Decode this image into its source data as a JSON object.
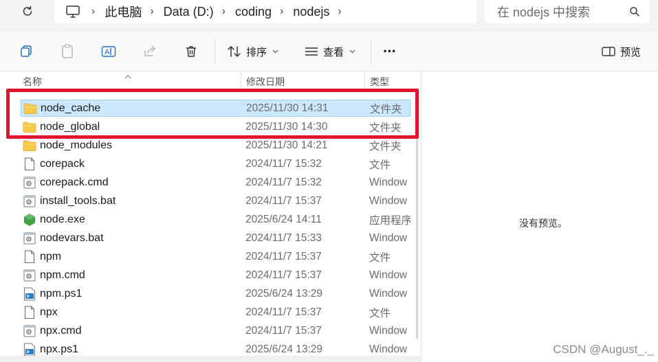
{
  "address": {
    "breadcrumbs": [
      "此电脑",
      "Data (D:)",
      "coding",
      "nodejs"
    ]
  },
  "search": {
    "placeholder": "在 nodejs 中搜索"
  },
  "toolbar": {
    "sort_label": "排序",
    "view_label": "查看",
    "more_label": "···",
    "preview_label": "预览"
  },
  "columns": {
    "name": "名称",
    "modified": "修改日期",
    "type": "类型"
  },
  "files": [
    {
      "name": "node_cache",
      "modified": "2025/11/30 14:31",
      "type": "文件夹",
      "icon": "folder-icon"
    },
    {
      "name": "node_global",
      "modified": "2025/11/30 14:30",
      "type": "文件夹",
      "icon": "folder-icon"
    },
    {
      "name": "node_modules",
      "modified": "2025/11/30 14:21",
      "type": "文件夹",
      "icon": "folder-icon"
    },
    {
      "name": "corepack",
      "modified": "2024/11/7 15:32",
      "type": "文件",
      "icon": "file-icon"
    },
    {
      "name": "corepack.cmd",
      "modified": "2024/11/7 15:32",
      "type": "Window",
      "icon": "script-icon"
    },
    {
      "name": "install_tools.bat",
      "modified": "2024/11/7 15:37",
      "type": "Window",
      "icon": "script-icon"
    },
    {
      "name": "node.exe",
      "modified": "2025/6/24 14:11",
      "type": "应用程序",
      "icon": "node-exe-icon"
    },
    {
      "name": "nodevars.bat",
      "modified": "2024/11/7 15:33",
      "type": "Window",
      "icon": "script-icon"
    },
    {
      "name": "npm",
      "modified": "2024/11/7 15:37",
      "type": "文件",
      "icon": "file-icon"
    },
    {
      "name": "npm.cmd",
      "modified": "2024/11/7 15:37",
      "type": "Window",
      "icon": "script-icon"
    },
    {
      "name": "npm.ps1",
      "modified": "2025/6/24 13:29",
      "type": "Window",
      "icon": "powershell-icon"
    },
    {
      "name": "npx",
      "modified": "2024/11/7 15:37",
      "type": "文件",
      "icon": "file-icon"
    },
    {
      "name": "npx.cmd",
      "modified": "2024/11/7 15:37",
      "type": "Window",
      "icon": "script-icon"
    },
    {
      "name": "npx.ps1",
      "modified": "2025/6/24 13:29",
      "type": "Window",
      "icon": "powershell-icon"
    }
  ],
  "preview_pane": {
    "empty_text": "没有预览。"
  },
  "watermark": "CSDN @August_._",
  "colors": {
    "selection": "#cce8ff",
    "highlight_border": "#e0152d",
    "folder": "#f8c94a"
  }
}
